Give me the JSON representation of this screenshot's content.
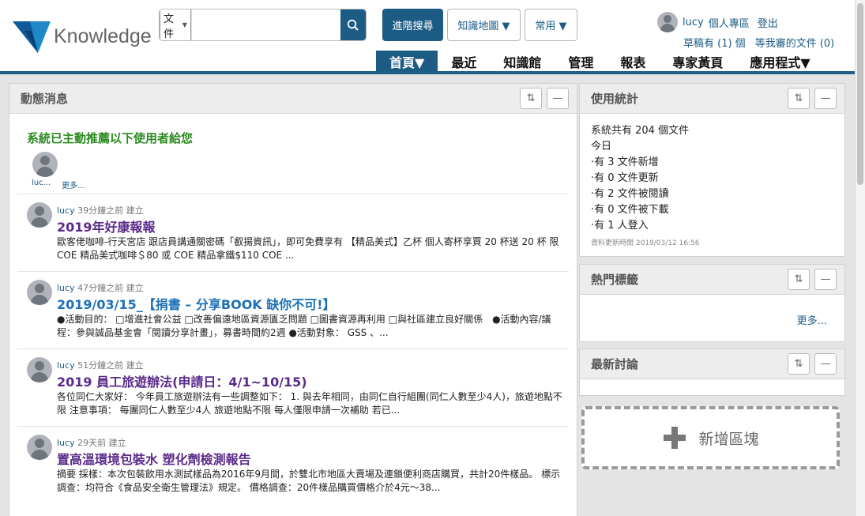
{
  "brand": {
    "name": "Knowledge",
    "primary_color": "#1c5b84",
    "accent_color": "#2a8a1e"
  },
  "search": {
    "scope_label": "文件",
    "placeholder": "",
    "search_icon": "search-icon"
  },
  "toolbar": {
    "advanced_search": "進階搜尋",
    "knowledge_map": "知識地圖 ▼",
    "favorites": "常用 ▼"
  },
  "user": {
    "name": "lucy",
    "personal_area": "個人專區",
    "logout": "登出",
    "drafts": "草稿有 (1) 個",
    "pending_review": "等我審的文件 (0)"
  },
  "nav": [
    {
      "label": "首頁▼",
      "active": true
    },
    {
      "label": "最近",
      "active": false
    },
    {
      "label": "知識館",
      "active": false
    },
    {
      "label": "管理",
      "active": false
    },
    {
      "label": "報表",
      "active": false
    },
    {
      "label": "專家黃頁",
      "active": false
    },
    {
      "label": "應用程式▼",
      "active": false
    }
  ],
  "news": {
    "title": "動態消息",
    "recommend_title": "系統已主動推薦以下使用者給您",
    "recommend_user": "luc...",
    "recommend_more": "更多...",
    "items": [
      {
        "user": "lucy",
        "meta": " 39分鐘之前 建立",
        "title": "2019年好康報報",
        "title_color": "#5a2a8a",
        "body": "歐客佬咖啡-行天宮店 跟店員講通關密碼「叡揚資訊」，即可免費享有 【精品美式】乙杯 個人寄杯享買 20 杯送 20 杯 限 COE 精品美式咖啡＄80 或 COE 精品拿鐵$110 COE ..."
      },
      {
        "user": "lucy",
        "meta": " 47分鐘之前 建立",
        "title": "2019/03/15_【捐書 – 分享BOOK 缺你不可!】",
        "title_color": "#1c6fb8",
        "body": "●活動目的： □增進社會公益 □改善偏遠地區資源匱乏問題 □圖書資源再利用 □與社區建立良好關係　●活動內容/議程：參與誠品基金會「閱讀分享計畫」，募書時間約2週 ●活動對象： GSS 、..."
      },
      {
        "user": "lucy",
        "meta": " 51分鐘之前 建立",
        "title": "2019 員工旅遊辦法(申請日：4/1~10/15)",
        "title_color": "#5a2a8a",
        "body": "各位同仁大家好： 今年員工旅遊辦法有一些調整如下： 1. 與去年相同，由同仁自行組團(同仁人數至少4人)，旅遊地點不限 注意事項： 每團同仁人數至少4人 旅遊地點不限 每人僅限申請一次補助 若已..."
      },
      {
        "user": "lucy",
        "meta": " 29天前 建立",
        "title": "置高溫環境包裝水 塑化劑檢測報告",
        "title_color": "#5a2a8a",
        "body": "摘要 採樣：本次包裝飲用水測試樣品為2016年9月間，於雙北市地區大賣場及連鎖便利商店購買，共計20件樣品。 標示調查：均符合《食品安全衛生管理法》規定。 價格調查：20件樣品購買價格介於4元～38..."
      }
    ]
  },
  "stats": {
    "title": "使用統計",
    "lines": [
      "系統共有 204 個文件",
      "今日",
      "·有 3 文件新增",
      "·有 0 文件更新",
      "·有 2 文件被閱讀",
      "·有 0 文件被下載",
      "·有 1 人登入"
    ],
    "updated": "資料更新時間 2019/03/12 16:56"
  },
  "hot_tags": {
    "title": "熱門標籤",
    "more": "更多..."
  },
  "latest_discussion": {
    "title": "最新討論"
  },
  "add_block": {
    "label": "新增區塊"
  }
}
